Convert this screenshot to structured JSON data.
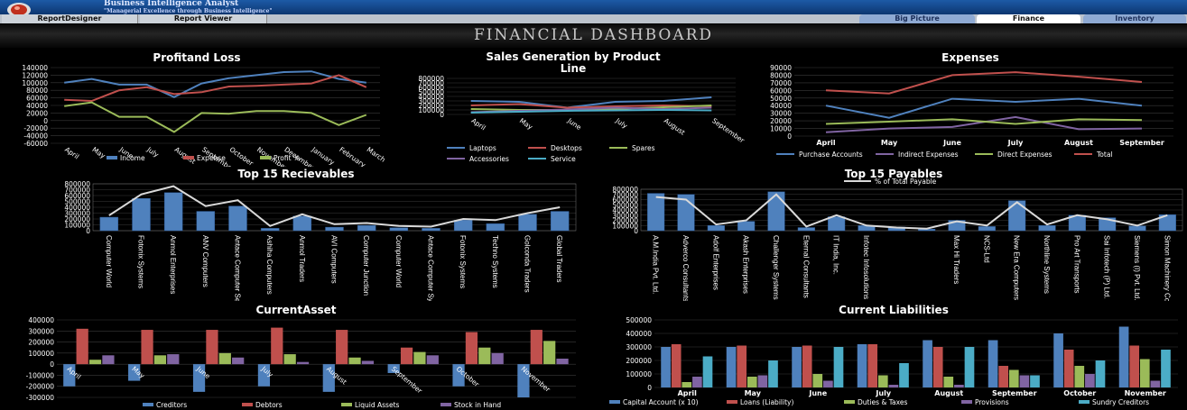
{
  "header": {
    "brand_title": "Business Intelligence Analyst",
    "brand_tagline": "\"Managerial Excellence through Business Intelligence\""
  },
  "nav": {
    "report_designer": "ReportDesigner",
    "report_viewer": "Report Viewer"
  },
  "tabs": [
    {
      "label": "Big Picture",
      "active": false
    },
    {
      "label": "Finance",
      "active": true
    },
    {
      "label": "Inventory",
      "active": false
    }
  ],
  "dashboard_title": "FINANCIAL DASHBOARD",
  "colors": {
    "blue": "#4f81bd",
    "red": "#c0504d",
    "green": "#9bbb59",
    "purple": "#8064a2",
    "cyan": "#4bacc6",
    "gray": "#d9d9d9"
  },
  "chart_data": [
    {
      "id": "pnl",
      "type": "line",
      "title": "Profitand Loss",
      "categories": [
        "April",
        "May",
        "June",
        "July",
        "August",
        "September",
        "October",
        "November",
        "December",
        "January",
        "February",
        "March"
      ],
      "ylim": [
        -60000,
        140000
      ],
      "yticks": [
        "140000",
        "120000",
        "100000",
        "80000",
        "60000",
        "40000",
        "20000",
        "0",
        "-20000",
        "-40000",
        "-60000"
      ],
      "series": [
        {
          "name": "Income",
          "color": "#4f81bd",
          "values": [
            100000,
            110000,
            95000,
            95000,
            62000,
            98000,
            112000,
            120000,
            128000,
            130000,
            110000,
            100000
          ]
        },
        {
          "name": "Expense",
          "color": "#c0504d",
          "values": [
            55000,
            52000,
            80000,
            88000,
            70000,
            75000,
            90000,
            92000,
            95000,
            98000,
            120000,
            88000
          ]
        },
        {
          "name": "Profit %",
          "color": "#9bbb59",
          "values": [
            38000,
            48000,
            10000,
            10000,
            -30000,
            20000,
            18000,
            25000,
            25000,
            20000,
            -12000,
            15000
          ]
        }
      ],
      "legend": "bottom"
    },
    {
      "id": "sales",
      "type": "line",
      "title": "Sales Generation by Product Line",
      "categories": [
        "April",
        "May",
        "June",
        "July",
        "August",
        "September"
      ],
      "ylim": [
        0,
        800000
      ],
      "yticks": [
        "800000",
        "700000",
        "600000",
        "500000",
        "400000",
        "300000",
        "200000",
        "100000",
        "0"
      ],
      "series": [
        {
          "name": "Laptops",
          "color": "#4f81bd",
          "values": [
            300000,
            280000,
            150000,
            280000,
            300000,
            380000
          ]
        },
        {
          "name": "Desktops",
          "color": "#c0504d",
          "values": [
            200000,
            230000,
            150000,
            180000,
            200000,
            180000
          ]
        },
        {
          "name": "Spares",
          "color": "#9bbb59",
          "values": [
            120000,
            100000,
            100000,
            120000,
            160000,
            200000
          ]
        },
        {
          "name": "Accessories",
          "color": "#8064a2",
          "values": [
            50000,
            80000,
            110000,
            150000,
            120000,
            150000
          ]
        },
        {
          "name": "Service",
          "color": "#4bacc6",
          "values": [
            40000,
            60000,
            80000,
            90000,
            100000,
            90000
          ]
        }
      ],
      "legend": "bottom"
    },
    {
      "id": "expenses",
      "type": "line",
      "title": "Expenses",
      "categories": [
        "April",
        "May",
        "June",
        "July",
        "August",
        "September"
      ],
      "ylim": [
        0,
        90000
      ],
      "yticks": [
        "90000",
        "80000",
        "70000",
        "60000",
        "50000",
        "40000",
        "30000",
        "20000",
        "10000",
        "0"
      ],
      "series": [
        {
          "name": "Purchase Accounts",
          "color": "#4f81bd",
          "values": [
            40000,
            24000,
            49000,
            45000,
            49000,
            40000
          ]
        },
        {
          "name": "Indirect Expenses",
          "color": "#8064a2",
          "values": [
            5000,
            10000,
            12000,
            25000,
            9000,
            10000
          ]
        },
        {
          "name": "Direct Expenses",
          "color": "#9bbb59",
          "values": [
            16000,
            19000,
            22000,
            16000,
            22000,
            21000
          ]
        },
        {
          "name": "Total",
          "color": "#c0504d",
          "values": [
            60000,
            56000,
            80000,
            84000,
            78000,
            71000
          ]
        }
      ],
      "legend": "bottom"
    },
    {
      "id": "recv",
      "type": "bar",
      "title": "Top 15 Recievables",
      "categories": [
        "Computer World",
        "Fotonix Systems",
        "Anmol Enterprises",
        "ANV Computers",
        "Antace Computer Services",
        "Ashiha Computers",
        "Anmol Traders",
        "AVI Computers",
        "Computer Junction",
        "Computer World",
        "Antace Computer Systems",
        "Fotonix Systems",
        "Techno Systems",
        "Golconda Traders",
        "Global Traders"
      ],
      "ylim": [
        0,
        800000
      ],
      "yticks": [
        "800000",
        "700000",
        "600000",
        "500000",
        "400000",
        "300000",
        "200000",
        "100000",
        "0"
      ],
      "values": [
        230000,
        550000,
        650000,
        330000,
        420000,
        40000,
        250000,
        60000,
        90000,
        50000,
        40000,
        180000,
        120000,
        280000,
        330000
      ],
      "line_values": [
        260000,
        620000,
        760000,
        420000,
        520000,
        80000,
        280000,
        110000,
        130000,
        80000,
        70000,
        200000,
        180000,
        300000,
        400000
      ]
    },
    {
      "id": "pay",
      "type": "bar",
      "title": "Top 15 Payables",
      "subtitle": "% of Total Payable",
      "categories": [
        "A.M.India Pvt. Ltd.",
        "Adverco Consultants",
        "Adolf Enterprises",
        "Akash Enterprises",
        "Challenger Systems",
        "Eternal Consultants",
        "IT India, Inc.",
        "Infotec Infosolutions",
        "",
        "",
        "Max Hi Traders",
        "NCS-Ltd",
        "New Era Computers",
        "Northline Systems",
        "Pro Art Transports",
        "Sai Infotech (P) Ltd.",
        "Siemens (I) Pvt. Ltd.",
        "Simon Machinery Co."
      ],
      "ylim": [
        0,
        800000
      ],
      "yticks": [
        "800000",
        "700000",
        "600000",
        "500000",
        "400000",
        "300000",
        "200000",
        "100000",
        "0"
      ],
      "values": [
        720000,
        700000,
        100000,
        180000,
        750000,
        60000,
        270000,
        100000,
        70000,
        30000,
        200000,
        80000,
        580000,
        100000,
        300000,
        250000,
        90000,
        310000
      ],
      "line_values": [
        650000,
        600000,
        120000,
        200000,
        700000,
        80000,
        300000,
        100000,
        60000,
        40000,
        180000,
        100000,
        550000,
        120000,
        300000,
        220000,
        100000,
        300000
      ]
    },
    {
      "id": "asset",
      "type": "bar",
      "title": "CurrentAsset",
      "categories": [
        "April",
        "May",
        "June",
        "July",
        "August",
        "September",
        "October",
        "November"
      ],
      "ylim": [
        -300000,
        400000
      ],
      "yticks": [
        "400000",
        "300000",
        "200000",
        "100000",
        "0",
        "-100000",
        "-200000",
        "-300000"
      ],
      "series": [
        {
          "name": "Creditors",
          "color": "#4f81bd",
          "values": [
            -200000,
            -150000,
            -250000,
            -200000,
            -250000,
            -80000,
            -200000,
            -300000
          ]
        },
        {
          "name": "Debtors",
          "color": "#c0504d",
          "values": [
            320000,
            310000,
            310000,
            330000,
            310000,
            150000,
            290000,
            310000
          ]
        },
        {
          "name": "Liquid Assets",
          "color": "#9bbb59",
          "values": [
            40000,
            80000,
            100000,
            90000,
            60000,
            110000,
            150000,
            210000
          ]
        },
        {
          "name": "Stock in Hand",
          "color": "#8064a2",
          "values": [
            80000,
            90000,
            60000,
            20000,
            30000,
            80000,
            100000,
            50000
          ]
        }
      ],
      "legend": "bottom"
    },
    {
      "id": "liab",
      "type": "bar",
      "title": "Current Liabilities",
      "categories": [
        "April",
        "May",
        "June",
        "July",
        "August",
        "September",
        "October",
        "November"
      ],
      "ylim": [
        0,
        500000
      ],
      "yticks": [
        "500000",
        "400000",
        "300000",
        "200000",
        "100000",
        "0"
      ],
      "series": [
        {
          "name": "Capital Account (x 10)",
          "color": "#4f81bd",
          "values": [
            300000,
            300000,
            300000,
            320000,
            350000,
            350000,
            400000,
            450000
          ]
        },
        {
          "name": "Loans (Liability)",
          "color": "#c0504d",
          "values": [
            320000,
            310000,
            310000,
            320000,
            300000,
            160000,
            280000,
            310000
          ]
        },
        {
          "name": "Duties & Taxes",
          "color": "#9bbb59",
          "values": [
            40000,
            80000,
            100000,
            90000,
            80000,
            130000,
            160000,
            210000
          ]
        },
        {
          "name": "Provisions",
          "color": "#8064a2",
          "values": [
            80000,
            90000,
            50000,
            20000,
            20000,
            90000,
            100000,
            50000
          ]
        },
        {
          "name": "Sundry Creditors",
          "color": "#4bacc6",
          "values": [
            230000,
            200000,
            300000,
            180000,
            300000,
            90000,
            200000,
            280000
          ]
        }
      ],
      "legend": "bottom"
    }
  ]
}
